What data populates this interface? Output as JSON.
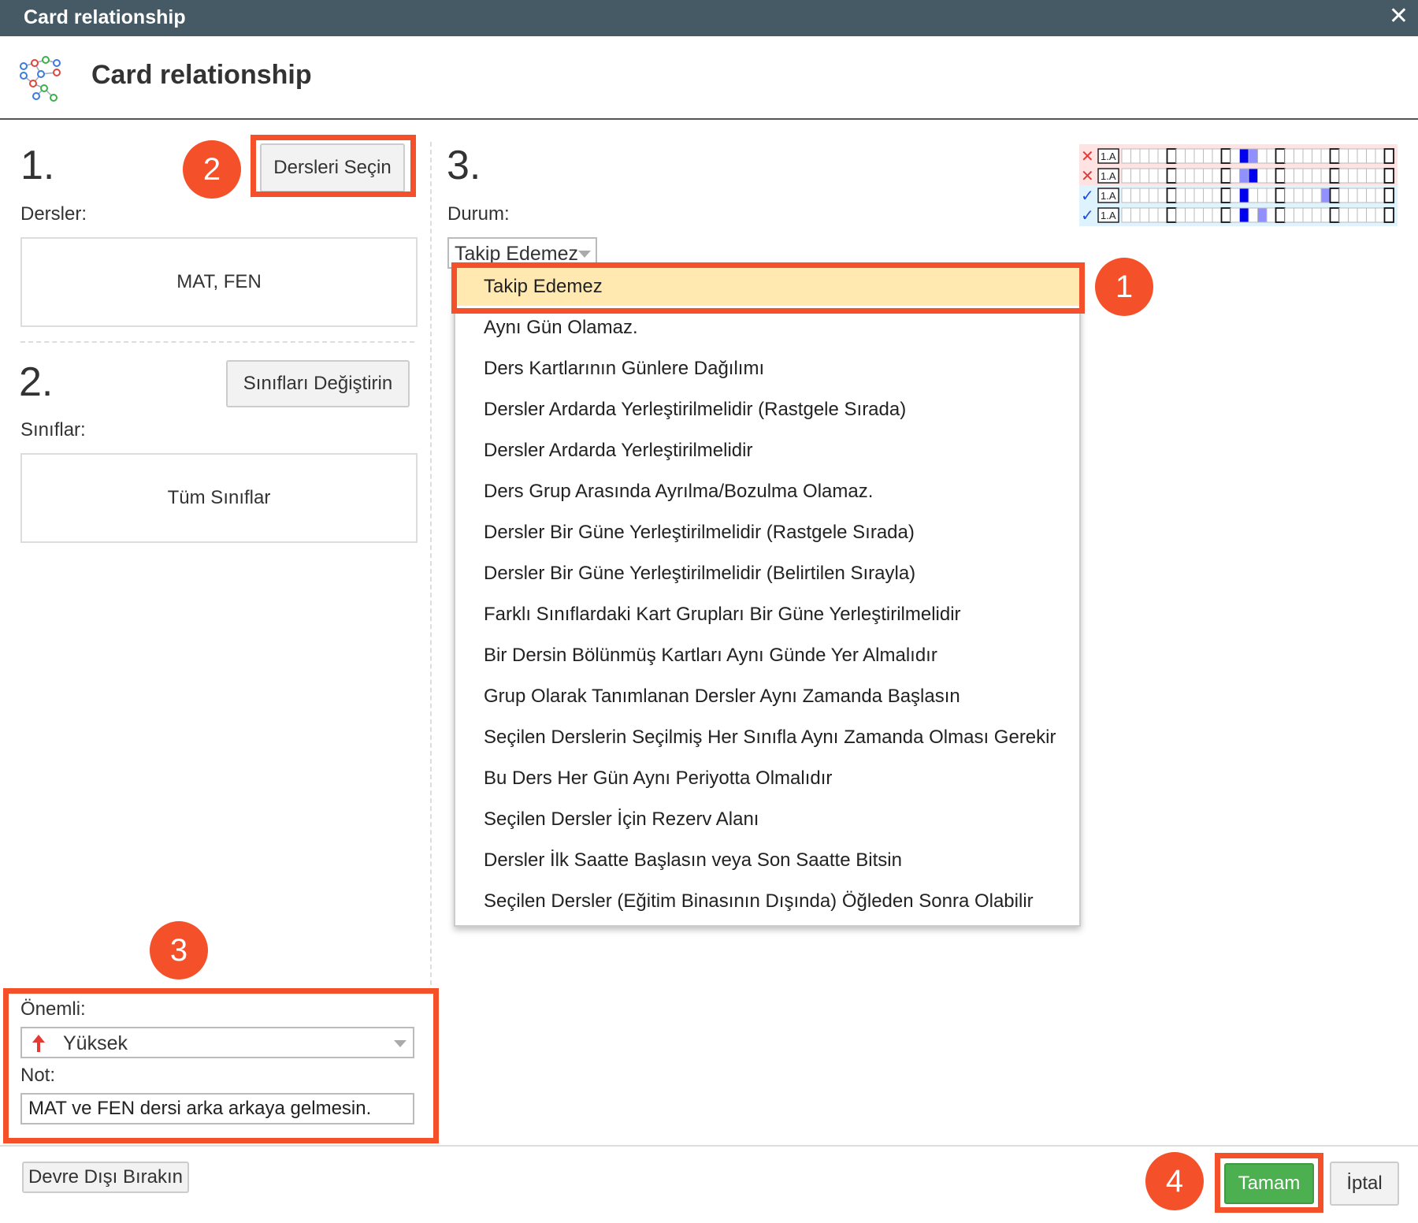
{
  "window": {
    "title": "Card relationship",
    "close_glyph": "✕"
  },
  "header": {
    "title": "Card relationship",
    "icon": "relationship-network-icon"
  },
  "section1": {
    "number": "1.",
    "label": "Dersler:",
    "select_button": "Dersleri Seçin",
    "value": "MAT, FEN"
  },
  "section2": {
    "number": "2.",
    "label": "Sınıflar:",
    "change_button": "Sınıfları Değiştirin",
    "value": "Tüm Sınıflar"
  },
  "section3": {
    "number": "3.",
    "label": "Durum:",
    "selected": "Takip Edemez",
    "options": [
      "Takip Edemez",
      "Aynı Gün Olamaz.",
      "Ders Kartlarının Günlere Dağılımı",
      "Dersler Ardarda Yerleştirilmelidir (Rastgele Sırada)",
      "Dersler Ardarda Yerleştirilmelidir",
      "Ders Grup Arasında Ayrılma/Bozulma Olamaz.",
      "Dersler Bir Güne Yerleştirilmelidir (Rastgele Sırada)",
      "Dersler Bir Güne Yerleştirilmelidir (Belirtilen Sırayla)",
      "Farklı Sınıflardaki Kart Grupları Bir Güne Yerleştirilmelidir",
      "Bir Dersin Bölünmüş Kartları Aynı Günde Yer Almalıdır",
      "Grup Olarak Tanımlanan Dersler Aynı Zamanda Başlasın",
      "Seçilen Derslerin Seçilmiş Her Sınıfla Aynı Zamanda Olması Gerekir",
      "Bu Ders Her Gün Aynı Periyotta Olmalıdır",
      "Seçilen Dersler İçin Rezerv Alanı",
      "Dersler İlk Saatte Başlasın veya Son Saatte Bitsin",
      "Seçilen Dersler (Eğitim Binasının Dışında) Öğleden Sonra Olabilir"
    ],
    "preview": {
      "row_label": "1.A",
      "rows": [
        {
          "status": "invalid",
          "status_icon": "cross-icon",
          "color": "#e53935"
        },
        {
          "status": "invalid",
          "status_icon": "cross-icon",
          "color": "#e53935"
        },
        {
          "status": "valid",
          "status_icon": "check-icon",
          "color": "#1e4fd8"
        },
        {
          "status": "valid",
          "status_icon": "check-icon",
          "color": "#1e4fd8"
        }
      ]
    }
  },
  "importance": {
    "label": "Önemli:",
    "value": "Yüksek",
    "icon": "arrow-up-icon",
    "icon_color": "#e53935"
  },
  "note": {
    "label": "Not:",
    "value": "MAT ve FEN dersi arka arkaya gelmesin."
  },
  "footer": {
    "disable_button": "Devre Dışı Bırakın",
    "ok_button": "Tamam",
    "cancel_button": "İptal"
  },
  "annotations": {
    "marker1": "1",
    "marker2": "2",
    "marker3": "3",
    "marker4": "4"
  },
  "colors": {
    "titlebar": "#455a64",
    "highlight": "#f4502a",
    "selected_option": "#ffe9b0",
    "ok_button": "#4caf50"
  }
}
